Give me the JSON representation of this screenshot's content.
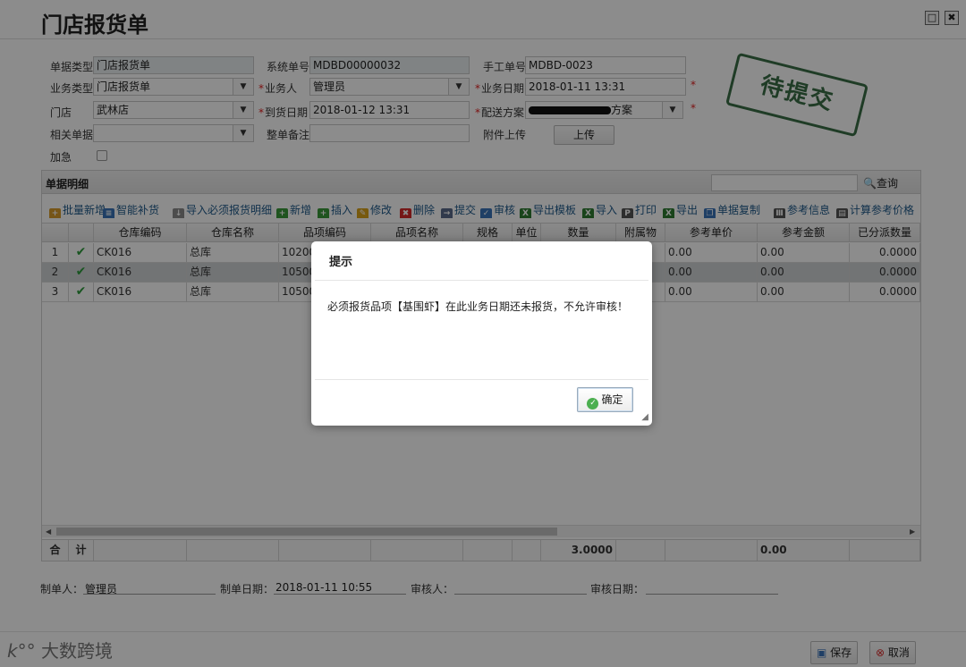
{
  "window": {
    "title": "门店报货单",
    "restore_icon": "□",
    "close_icon": "✖"
  },
  "form": {
    "doc_type_label": "单据类型",
    "doc_type_value": "门店报货单",
    "sys_no_label": "系统单号",
    "sys_no_value": "MDBD00000032",
    "manual_no_label": "手工单号",
    "manual_no_value": "MDBD-0023",
    "biz_type_label": "业务类型",
    "biz_type_value": "门店报货单",
    "operator_label": "业务人",
    "operator_value": "管理员",
    "biz_date_label": "业务日期",
    "biz_date_value": "2018-01-11 13:31",
    "store_label": "门店",
    "store_value": "武林店",
    "arrival_label": "到货日期",
    "arrival_value": "2018-01-12 13:31",
    "delivery_label": "配送方案",
    "delivery_value": "方案",
    "related_label": "相关单据",
    "related_value": "",
    "remark_label": "整单备注",
    "remark_value": "",
    "attach_label": "附件上传",
    "upload_label": "上传",
    "urgent_label": "加急",
    "required_mark": "*",
    "dropdown_arrow": "▼"
  },
  "stamp": {
    "text": "待提交"
  },
  "detail": {
    "title": "单据明细",
    "search_label": "查询",
    "toolbar": [
      {
        "name": "batch-add",
        "label": "批量新增",
        "icon": "+",
        "color": "#d89b2b"
      },
      {
        "name": "smart-replenish",
        "label": "智能补货",
        "icon": "≡",
        "color": "#3a73b8"
      },
      {
        "name": "import-required",
        "label": "导入必须报货明细",
        "icon": "↓",
        "color": "#8a8a8a"
      },
      {
        "name": "add",
        "label": "新增",
        "icon": "+",
        "color": "#3a9a3a"
      },
      {
        "name": "insert",
        "label": "插入",
        "icon": "+",
        "color": "#3a9a3a"
      },
      {
        "name": "edit",
        "label": "修改",
        "icon": "✎",
        "color": "#d9a21b"
      },
      {
        "name": "delete",
        "label": "删除",
        "icon": "✖",
        "color": "#d62b2b"
      },
      {
        "name": "submit",
        "label": "提交",
        "icon": "→",
        "color": "#5a6a8a"
      },
      {
        "name": "audit",
        "label": "审核",
        "icon": "✓",
        "color": "#3a73b8"
      },
      {
        "name": "export-template",
        "label": "导出模板",
        "icon": "X",
        "color": "#2e7d32"
      },
      {
        "name": "import",
        "label": "导入",
        "icon": "X",
        "color": "#2e7d32"
      },
      {
        "name": "print",
        "label": "打印",
        "icon": "P",
        "color": "#555555"
      },
      {
        "name": "export",
        "label": "导出",
        "icon": "X",
        "color": "#2e7d32"
      },
      {
        "name": "copy-doc",
        "label": "单据复制",
        "icon": "❐",
        "color": "#3a73b8"
      },
      {
        "name": "ref-info",
        "label": "参考信息",
        "icon": "Ⅲ",
        "color": "#555555"
      },
      {
        "name": "calc-ref-price",
        "label": "计算参考价格",
        "icon": "▤",
        "color": "#555555"
      }
    ],
    "columns": [
      "",
      "",
      "仓库编码",
      "仓库名称",
      "品项编码",
      "品项名称",
      "规格",
      "单位",
      "数量",
      "附属物",
      "参考单价",
      "参考金额",
      "已分派数量"
    ],
    "rows": [
      {
        "no": "1",
        "check": "✔",
        "wh_code": "CK016",
        "wh_name": "总库",
        "item_code": "10200",
        "price": "0.00",
        "amount": "0.00",
        "assigned": "0.0000"
      },
      {
        "no": "2",
        "check": "✔",
        "wh_code": "CK016",
        "wh_name": "总库",
        "item_code": "10500",
        "price": "0.00",
        "amount": "0.00",
        "assigned": "0.0000"
      },
      {
        "no": "3",
        "check": "✔",
        "wh_code": "CK016",
        "wh_name": "总库",
        "item_code": "10500",
        "price": "0.00",
        "amount": "0.00",
        "assigned": "0.0000"
      }
    ],
    "total": {
      "he": "合",
      "ji": "计",
      "qty": "3.0000",
      "amount": "0.00"
    }
  },
  "footer": {
    "maker_label": "制单人：",
    "maker_value": "管理员",
    "make_date_label": "制单日期：",
    "make_date_value": "2018-01-11 10:55",
    "auditor_label": "审核人：",
    "audit_date_label": "审核日期："
  },
  "bottom": {
    "watermark": "大数跨境",
    "save_label": "保存",
    "cancel_label": "取消"
  },
  "dialog": {
    "title": "提示",
    "message": "必须报货品项【基围虾】在此业务日期还未报货，不允许审核！",
    "ok_label": "确定"
  }
}
